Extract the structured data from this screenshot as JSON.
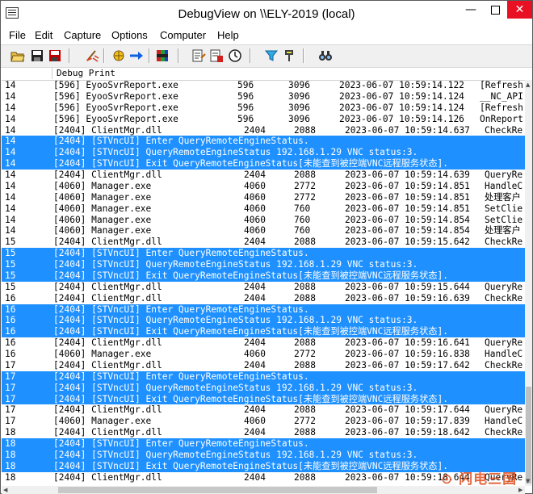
{
  "window": {
    "title": "DebugView on \\\\ELY-2019 (local)",
    "close_glyph": "✕",
    "min_glyph": "—"
  },
  "menu": [
    "File",
    "Edit",
    "Capture",
    "Options",
    "Computer",
    "Help"
  ],
  "toolbar_icons": [
    "open-icon",
    "save-icon",
    "save-as-icon",
    "clear-icon",
    "capture-icon",
    "autoscroll-icon",
    "highlight-icon",
    "log-boot-icon",
    "history-icon",
    "clock-icon",
    "filter-icon",
    "highlight-filter-icon",
    "find-icon"
  ],
  "header": {
    "col1": "",
    "col2": "Debug Print"
  },
  "colors": {
    "highlight": "#1e90ff",
    "close_button": "#e81123"
  },
  "rows": [
    {
      "t": "n",
      "c": [
        "14",
        "[596] EyooSvrReport.exe",
        "596",
        "3096",
        "2023-06-07 10:59:14.122",
        "[Refresh"
      ],
      "a": 1
    },
    {
      "t": "n",
      "c": [
        "14",
        "[596] EyooSvrReport.exe",
        "596",
        "3096",
        "2023-06-07 10:59:14.124",
        "__NC_API"
      ],
      "a": 1
    },
    {
      "t": "n",
      "c": [
        "14",
        "[596] EyooSvrReport.exe",
        "596",
        "3096",
        "2023-06-07 10:59:14.124",
        "[Refresh"
      ],
      "a": 1
    },
    {
      "t": "n",
      "c": [
        "14",
        "[596] EyooSvrReport.exe",
        "596",
        "3096",
        "2023-06-07 10:59:14.126",
        "OnReport"
      ],
      "a": 1
    },
    {
      "t": "n",
      "c": [
        "14",
        "[2404] ClientMgr.dll",
        "2404",
        "2088",
        "2023-06-07 10:59:14.637",
        "CheckRe"
      ]
    },
    {
      "t": "h",
      "c": [
        "14",
        "[2404] [STVncUI] Enter QueryRemoteEngineStatus."
      ]
    },
    {
      "t": "h",
      "c": [
        "14",
        "[2404] [STVncUI] QueryRemoteEngineStatus 192.168.1.29 VNC status:3."
      ]
    },
    {
      "t": "h",
      "c": [
        "14",
        "[2404] [STVncUI] Exit QueryRemoteEngineStatus[未能查到被控端VNC远程服务状态]."
      ]
    },
    {
      "t": "n",
      "c": [
        "14",
        "[2404] ClientMgr.dll",
        "2404",
        "2088",
        "2023-06-07 10:59:14.639",
        "QueryRe"
      ]
    },
    {
      "t": "n",
      "c": [
        "14",
        "[4060] Manager.exe",
        "4060",
        "2772",
        "2023-06-07 10:59:14.851",
        "HandleC"
      ]
    },
    {
      "t": "n",
      "c": [
        "14",
        "[4060] Manager.exe",
        "4060",
        "2772",
        "2023-06-07 10:59:14.851",
        "处理客户"
      ]
    },
    {
      "t": "n",
      "c": [
        "14",
        "[4060] Manager.exe",
        "4060",
        "760",
        "2023-06-07 10:59:14.851",
        "SetClie"
      ]
    },
    {
      "t": "n",
      "c": [
        "14",
        "[4060] Manager.exe",
        "4060",
        "760",
        "2023-06-07 10:59:14.854",
        "SetClie"
      ]
    },
    {
      "t": "n",
      "c": [
        "14",
        "[4060] Manager.exe",
        "4060",
        "760",
        "2023-06-07 10:59:14.854",
        "处理客户"
      ]
    },
    {
      "t": "n",
      "c": [
        "15",
        "[2404] ClientMgr.dll",
        "2404",
        "2088",
        "2023-06-07 10:59:15.642",
        "CheckRe"
      ]
    },
    {
      "t": "h",
      "c": [
        "15",
        "[2404] [STVncUI] Enter QueryRemoteEngineStatus."
      ]
    },
    {
      "t": "h",
      "c": [
        "15",
        "[2404] [STVncUI] QueryRemoteEngineStatus 192.168.1.29 VNC status:3."
      ]
    },
    {
      "t": "h",
      "c": [
        "15",
        "[2404] [STVncUI] Exit QueryRemoteEngineStatus[未能查到被控端VNC远程服务状态]."
      ]
    },
    {
      "t": "n",
      "c": [
        "15",
        "[2404] ClientMgr.dll",
        "2404",
        "2088",
        "2023-06-07 10:59:15.644",
        "QueryRe"
      ]
    },
    {
      "t": "n",
      "c": [
        "16",
        "[2404] ClientMgr.dll",
        "2404",
        "2088",
        "2023-06-07 10:59:16.639",
        "CheckRe"
      ]
    },
    {
      "t": "h",
      "c": [
        "16",
        "[2404] [STVncUI] Enter QueryRemoteEngineStatus."
      ]
    },
    {
      "t": "h",
      "c": [
        "16",
        "[2404] [STVncUI] QueryRemoteEngineStatus 192.168.1.29 VNC status:3."
      ]
    },
    {
      "t": "h",
      "c": [
        "16",
        "[2404] [STVncUI] Exit QueryRemoteEngineStatus[未能查到被控端VNC远程服务状态]."
      ]
    },
    {
      "t": "n",
      "c": [
        "16",
        "[2404] ClientMgr.dll",
        "2404",
        "2088",
        "2023-06-07 10:59:16.641",
        "QueryRe"
      ]
    },
    {
      "t": "n",
      "c": [
        "16",
        "[4060] Manager.exe",
        "4060",
        "2772",
        "2023-06-07 10:59:16.838",
        "HandleC"
      ]
    },
    {
      "t": "n",
      "c": [
        "17",
        "[2404] ClientMgr.dll",
        "2404",
        "2088",
        "2023-06-07 10:59:17.642",
        "CheckRe"
      ]
    },
    {
      "t": "h",
      "c": [
        "17",
        "[2404] [STVncUI] Enter QueryRemoteEngineStatus."
      ]
    },
    {
      "t": "h",
      "c": [
        "17",
        "[2404] [STVncUI] QueryRemoteEngineStatus 192.168.1.29 VNC status:3."
      ]
    },
    {
      "t": "h",
      "c": [
        "17",
        "[2404] [STVncUI] Exit QueryRemoteEngineStatus[未能查到被控端VNC远程服务状态]."
      ]
    },
    {
      "t": "n",
      "c": [
        "17",
        "[2404] ClientMgr.dll",
        "2404",
        "2088",
        "2023-06-07 10:59:17.644",
        "QueryRe"
      ]
    },
    {
      "t": "n",
      "c": [
        "17",
        "[4060] Manager.exe",
        "4060",
        "2772",
        "2023-06-07 10:59:17.839",
        "HandleC"
      ]
    },
    {
      "t": "n",
      "c": [
        "18",
        "[2404] ClientMgr.dll",
        "2404",
        "2088",
        "2023-06-07 10:59:18.642",
        "CheckRe"
      ]
    },
    {
      "t": "h",
      "c": [
        "18",
        "[2404] [STVncUI] Enter QueryRemoteEngineStatus."
      ]
    },
    {
      "t": "h",
      "c": [
        "18",
        "[2404] [STVncUI] QueryRemoteEngineStatus 192.168.1.29 VNC status:3."
      ]
    },
    {
      "t": "h",
      "c": [
        "18",
        "[2404] [STVncUI] Exit QueryRemoteEngineStatus[未能查到被控端VNC远程服务状态]."
      ]
    },
    {
      "t": "n",
      "c": [
        "18",
        "[2404] ClientMgr.dll",
        "2404",
        "2088",
        "2023-06-07 10:59:18.644",
        "QueryRe"
      ]
    }
  ],
  "watermark": "⊙ 闪电三国"
}
